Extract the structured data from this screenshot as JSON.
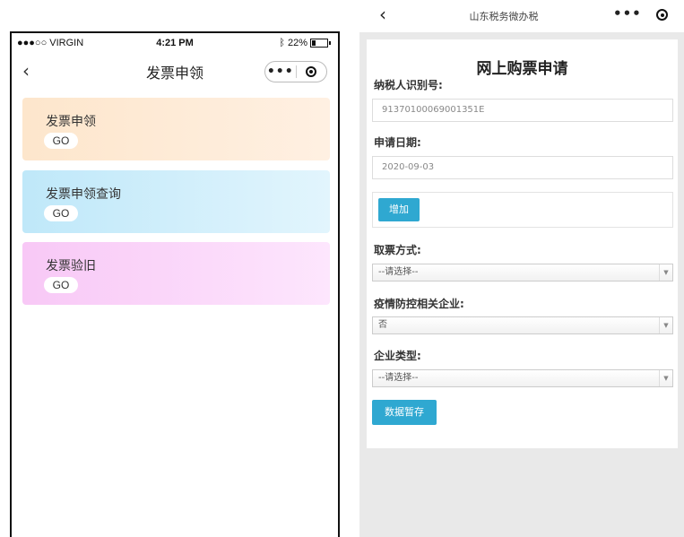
{
  "left": {
    "status": {
      "carrier": "●●●○○ VIRGIN",
      "time": "4:21 PM",
      "battery": "22%"
    },
    "nav": {
      "title": "发票申领",
      "more": "•••"
    },
    "cards": [
      {
        "title": "发票申领",
        "go": "GO",
        "color": "#fde6cc"
      },
      {
        "title": "发票申领查询",
        "go": "GO",
        "color": "#bfe8f9"
      },
      {
        "title": "发票验旧",
        "go": "GO",
        "color": "#f8c8f6"
      }
    ]
  },
  "right": {
    "nav": {
      "title": "山东税务微办税",
      "more": "•••"
    },
    "form": {
      "heading": "网上购票申请",
      "taxpayer_label": "纳税人识别号:",
      "taxpayer_value": "91370100069001351E",
      "date_label": "申请日期:",
      "date_value": "2020-09-03",
      "add_button": "增加",
      "pickup_label": "取票方式:",
      "pickup_value": "--请选择--",
      "epidemic_label": "疫情防控相关企业:",
      "epidemic_value": "否",
      "type_label": "企业类型:",
      "type_value": "--请选择--",
      "save_button": "数据暂存"
    },
    "accent": "#2fa8d1"
  }
}
